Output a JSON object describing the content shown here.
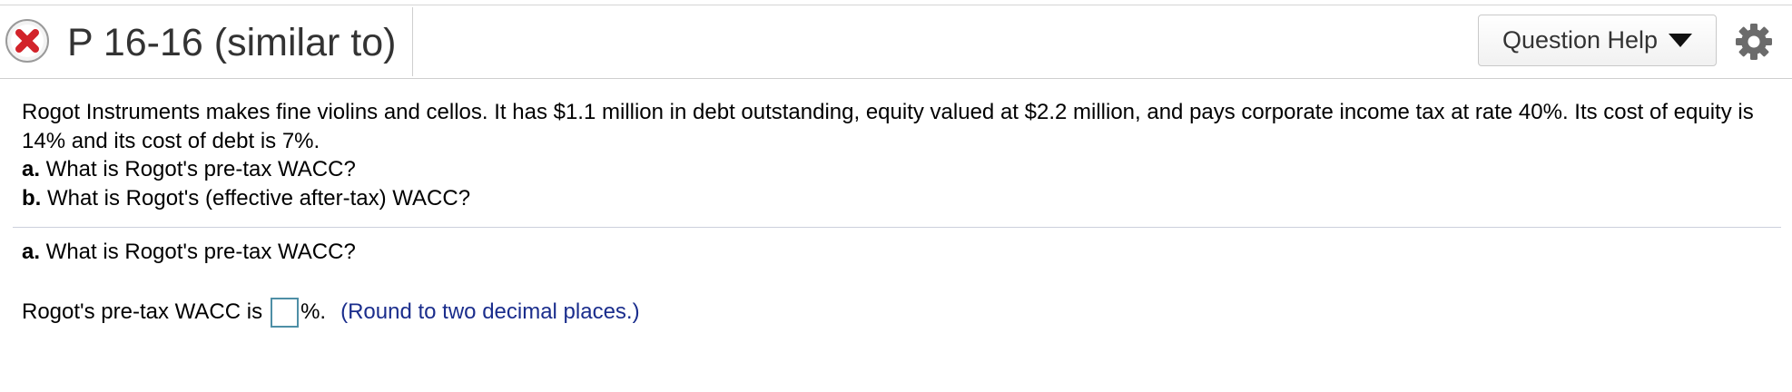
{
  "header": {
    "title": "P 16-16 (similar to)",
    "status_icon": "incorrect-x-icon",
    "help_label": "Question Help",
    "settings_icon": "gear-icon",
    "colors": {
      "status_red": "#d2232a",
      "hint_blue": "#1a2d8c"
    }
  },
  "problem": {
    "text": "Rogot Instruments makes fine violins and cellos. It has $1.1 million in debt outstanding, equity valued at $2.2 million, and pays corporate income tax at rate 40%. Its cost of equity is 14% and its cost of debt is 7%.",
    "part_a_label": "a.",
    "part_a_text": " What is Rogot's pre-tax WACC?",
    "part_b_label": "b.",
    "part_b_text": " What is Rogot's (effective after-tax) WACC?"
  },
  "current_part": {
    "label": "a.",
    "text": " What is Rogot's pre-tax WACC?",
    "answer_prefix": "Rogot's pre-tax WACC is",
    "answer_value": "",
    "answer_suffix": "%.",
    "hint": "(Round to two decimal places.)"
  }
}
